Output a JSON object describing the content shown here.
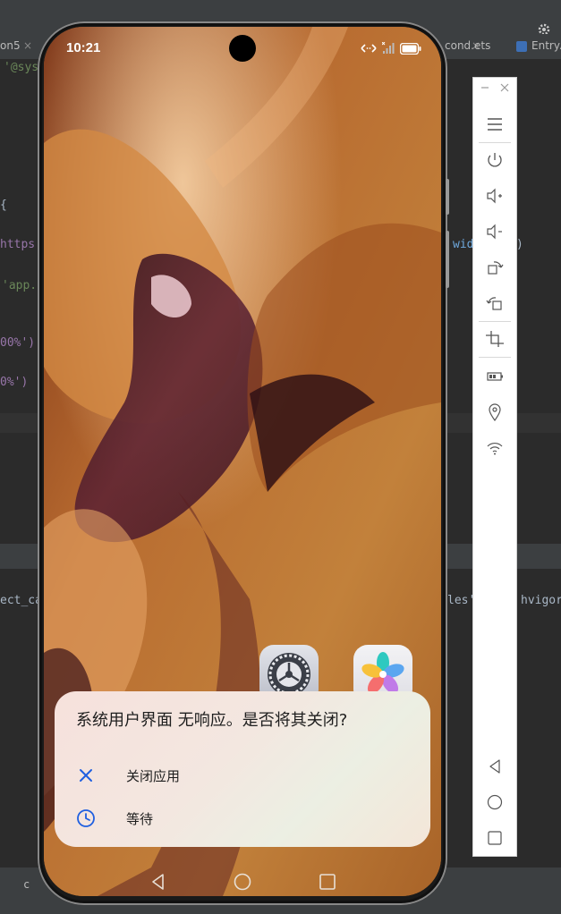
{
  "ide": {
    "tabs": [
      {
        "label": "on5"
      },
      {
        "label": "cond.ets"
      },
      {
        "label": "EntryA"
      }
    ],
    "code_fragments": [
      {
        "text": "'@sys"
      },
      {
        "text": "{"
      },
      {
        "text": "https:"
      },
      {
        "text": "'app."
      },
      {
        "text": "00%')"
      },
      {
        "text": "0%')"
      },
      {
        "text": "wid"
      },
      {
        "text": ")"
      },
      {
        "text": "ect_ca"
      },
      {
        "text": "les'"
      },
      {
        "text": "hvigor"
      }
    ],
    "bottom_label": "c"
  },
  "phone": {
    "status": {
      "time": "10:21"
    },
    "dialog": {
      "title": "系统用户界面 无响应。是否将其关闭?",
      "options": [
        {
          "label": "关闭应用",
          "icon": "close-icon"
        },
        {
          "label": "等待",
          "icon": "clock-icon"
        }
      ]
    },
    "home_icons": [
      {
        "name": "settings-app-icon"
      },
      {
        "name": "gallery-app-icon"
      }
    ],
    "navbar": [
      "back-icon",
      "home-icon",
      "recents-icon"
    ]
  },
  "emulator_panel": {
    "buttons": [
      "minimize-icon",
      "close-icon",
      "menu-icon",
      "power-icon",
      "volume-up-icon",
      "volume-down-icon",
      "rotate-right-icon",
      "rotate-left-icon",
      "screenshot-icon",
      "battery-icon",
      "location-icon",
      "wifi-icon",
      "back-icon",
      "home-icon",
      "recents-icon"
    ]
  },
  "colors": {
    "ide_bg": "#2b2b2b",
    "dialog_accent": "#1f5fe0",
    "wallpaper": "#b46a2c"
  }
}
